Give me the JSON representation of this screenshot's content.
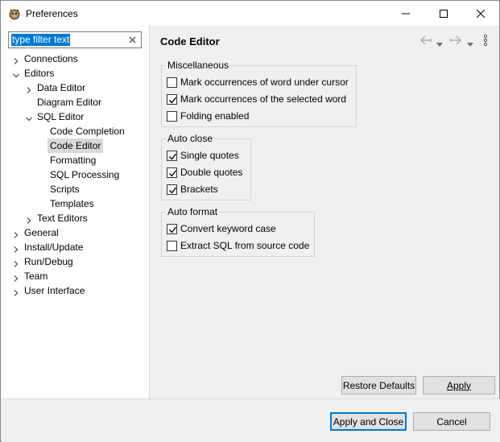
{
  "window": {
    "title": "Preferences"
  },
  "filter": {
    "value": "type filter text"
  },
  "tree": [
    {
      "label": "Connections",
      "expander": "right"
    },
    {
      "label": "Editors",
      "expander": "down"
    },
    {
      "label": "Data Editor",
      "expander": "right"
    },
    {
      "label": "Diagram Editor",
      "expander": "none"
    },
    {
      "label": "SQL Editor",
      "expander": "down"
    },
    {
      "label": "Code Completion",
      "expander": "none"
    },
    {
      "label": "Code Editor",
      "expander": "none",
      "selected": true
    },
    {
      "label": "Formatting",
      "expander": "none"
    },
    {
      "label": "SQL Processing",
      "expander": "none"
    },
    {
      "label": "Scripts",
      "expander": "none"
    },
    {
      "label": "Templates",
      "expander": "none"
    },
    {
      "label": "Text Editors",
      "expander": "right"
    },
    {
      "label": "General",
      "expander": "right"
    },
    {
      "label": "Install/Update",
      "expander": "right"
    },
    {
      "label": "Run/Debug",
      "expander": "right"
    },
    {
      "label": "Team",
      "expander": "right"
    },
    {
      "label": "User Interface",
      "expander": "right"
    }
  ],
  "page": {
    "title": "Code Editor"
  },
  "groups": {
    "misc": {
      "title": "Miscellaneous",
      "items": [
        {
          "label": "Mark occurrences of word under cursor",
          "checked": false
        },
        {
          "label": "Mark occurrences of the selected word",
          "checked": true
        },
        {
          "label": "Folding enabled",
          "checked": false
        }
      ]
    },
    "autoclose": {
      "title": "Auto close",
      "items": [
        {
          "label": "Single quotes",
          "checked": true
        },
        {
          "label": "Double quotes",
          "checked": true
        },
        {
          "label": "Brackets",
          "checked": true
        }
      ]
    },
    "autoformat": {
      "title": "Auto format",
      "items": [
        {
          "label": "Convert keyword case",
          "checked": true
        },
        {
          "label": "Extract SQL from source code",
          "checked": false
        }
      ]
    }
  },
  "buttons": {
    "restore_defaults": "Restore Defaults",
    "apply": "Apply",
    "apply_and_close": "Apply and Close",
    "cancel": "Cancel"
  },
  "colors": {
    "accent": "#0078d7",
    "selection": "#d9d9d9"
  }
}
